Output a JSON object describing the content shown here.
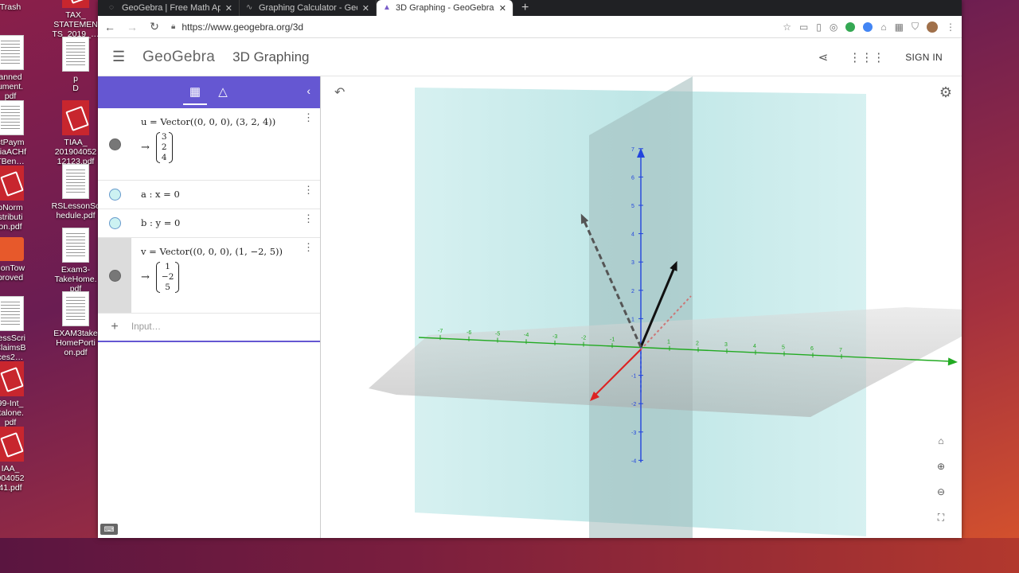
{
  "desktop": {
    "left_icons": [
      "Trash",
      "anned\nument.\npdf",
      "ctPaym\nViaACHf\nTBen…",
      "bNorm\nstributi\non.pdf",
      "gonTow\nproved",
      "ressScri\nClaimsB\nces2…",
      "99-Int_\nitalone.\npdf",
      "IAA_\n904052\n41.pdf"
    ],
    "mid_icons": [
      "TAX_\nSTATEMEN\nTS_2019_…",
      "p\nD",
      "TIAA_\n201904052\n12123.pdf",
      "RSLessonSc\nhedule.pdf",
      "Exam3-\nTakeHome.\npdf",
      "EXAM3take\nHomePorti\non.pdf"
    ]
  },
  "browser": {
    "tabs": [
      {
        "label": "GeoGebra | Free Math Ap",
        "icon": "geogebra-icon"
      },
      {
        "label": "Graphing Calculator - Geo",
        "icon": "graph-icon"
      },
      {
        "label": "3D Graphing - GeoGebra",
        "icon": "geogebra-3d-icon",
        "active": true
      }
    ],
    "url": "https://www.geogebra.org/3d"
  },
  "app": {
    "logo": "GeoGebra",
    "title": "3D Graphing",
    "sign_in": "SIGN IN"
  },
  "algebra": {
    "rows": [
      {
        "def": "u = Vector((0, 0, 0), (3, 2, 4))",
        "vals": [
          "3",
          "2",
          "4"
        ],
        "marker": "dark"
      },
      {
        "def": "a :  x = 0",
        "marker": "cyan"
      },
      {
        "def": "b :  y = 0",
        "marker": "cyan"
      },
      {
        "def": "v = Vector((0, 0, 0), (1, −2, 5))",
        "vals": [
          "1",
          "−2",
          "5"
        ],
        "marker": "dark",
        "selected": true
      }
    ],
    "input_placeholder": "Input…"
  },
  "axes": {
    "x_ticks": [
      "-7",
      "-6",
      "-5",
      "-4",
      "-3",
      "-2",
      "-1",
      "1",
      "2",
      "3",
      "4",
      "5",
      "6",
      "7"
    ],
    "z_ticks": [
      "7",
      "6",
      "5",
      "4",
      "3",
      "2",
      "1",
      "-1",
      "-2",
      "-3",
      "-4"
    ],
    "colors": {
      "x": "#22aa22",
      "y": "#dd2222",
      "z": "#2244dd",
      "u": "#111111",
      "v": "#555555"
    }
  }
}
